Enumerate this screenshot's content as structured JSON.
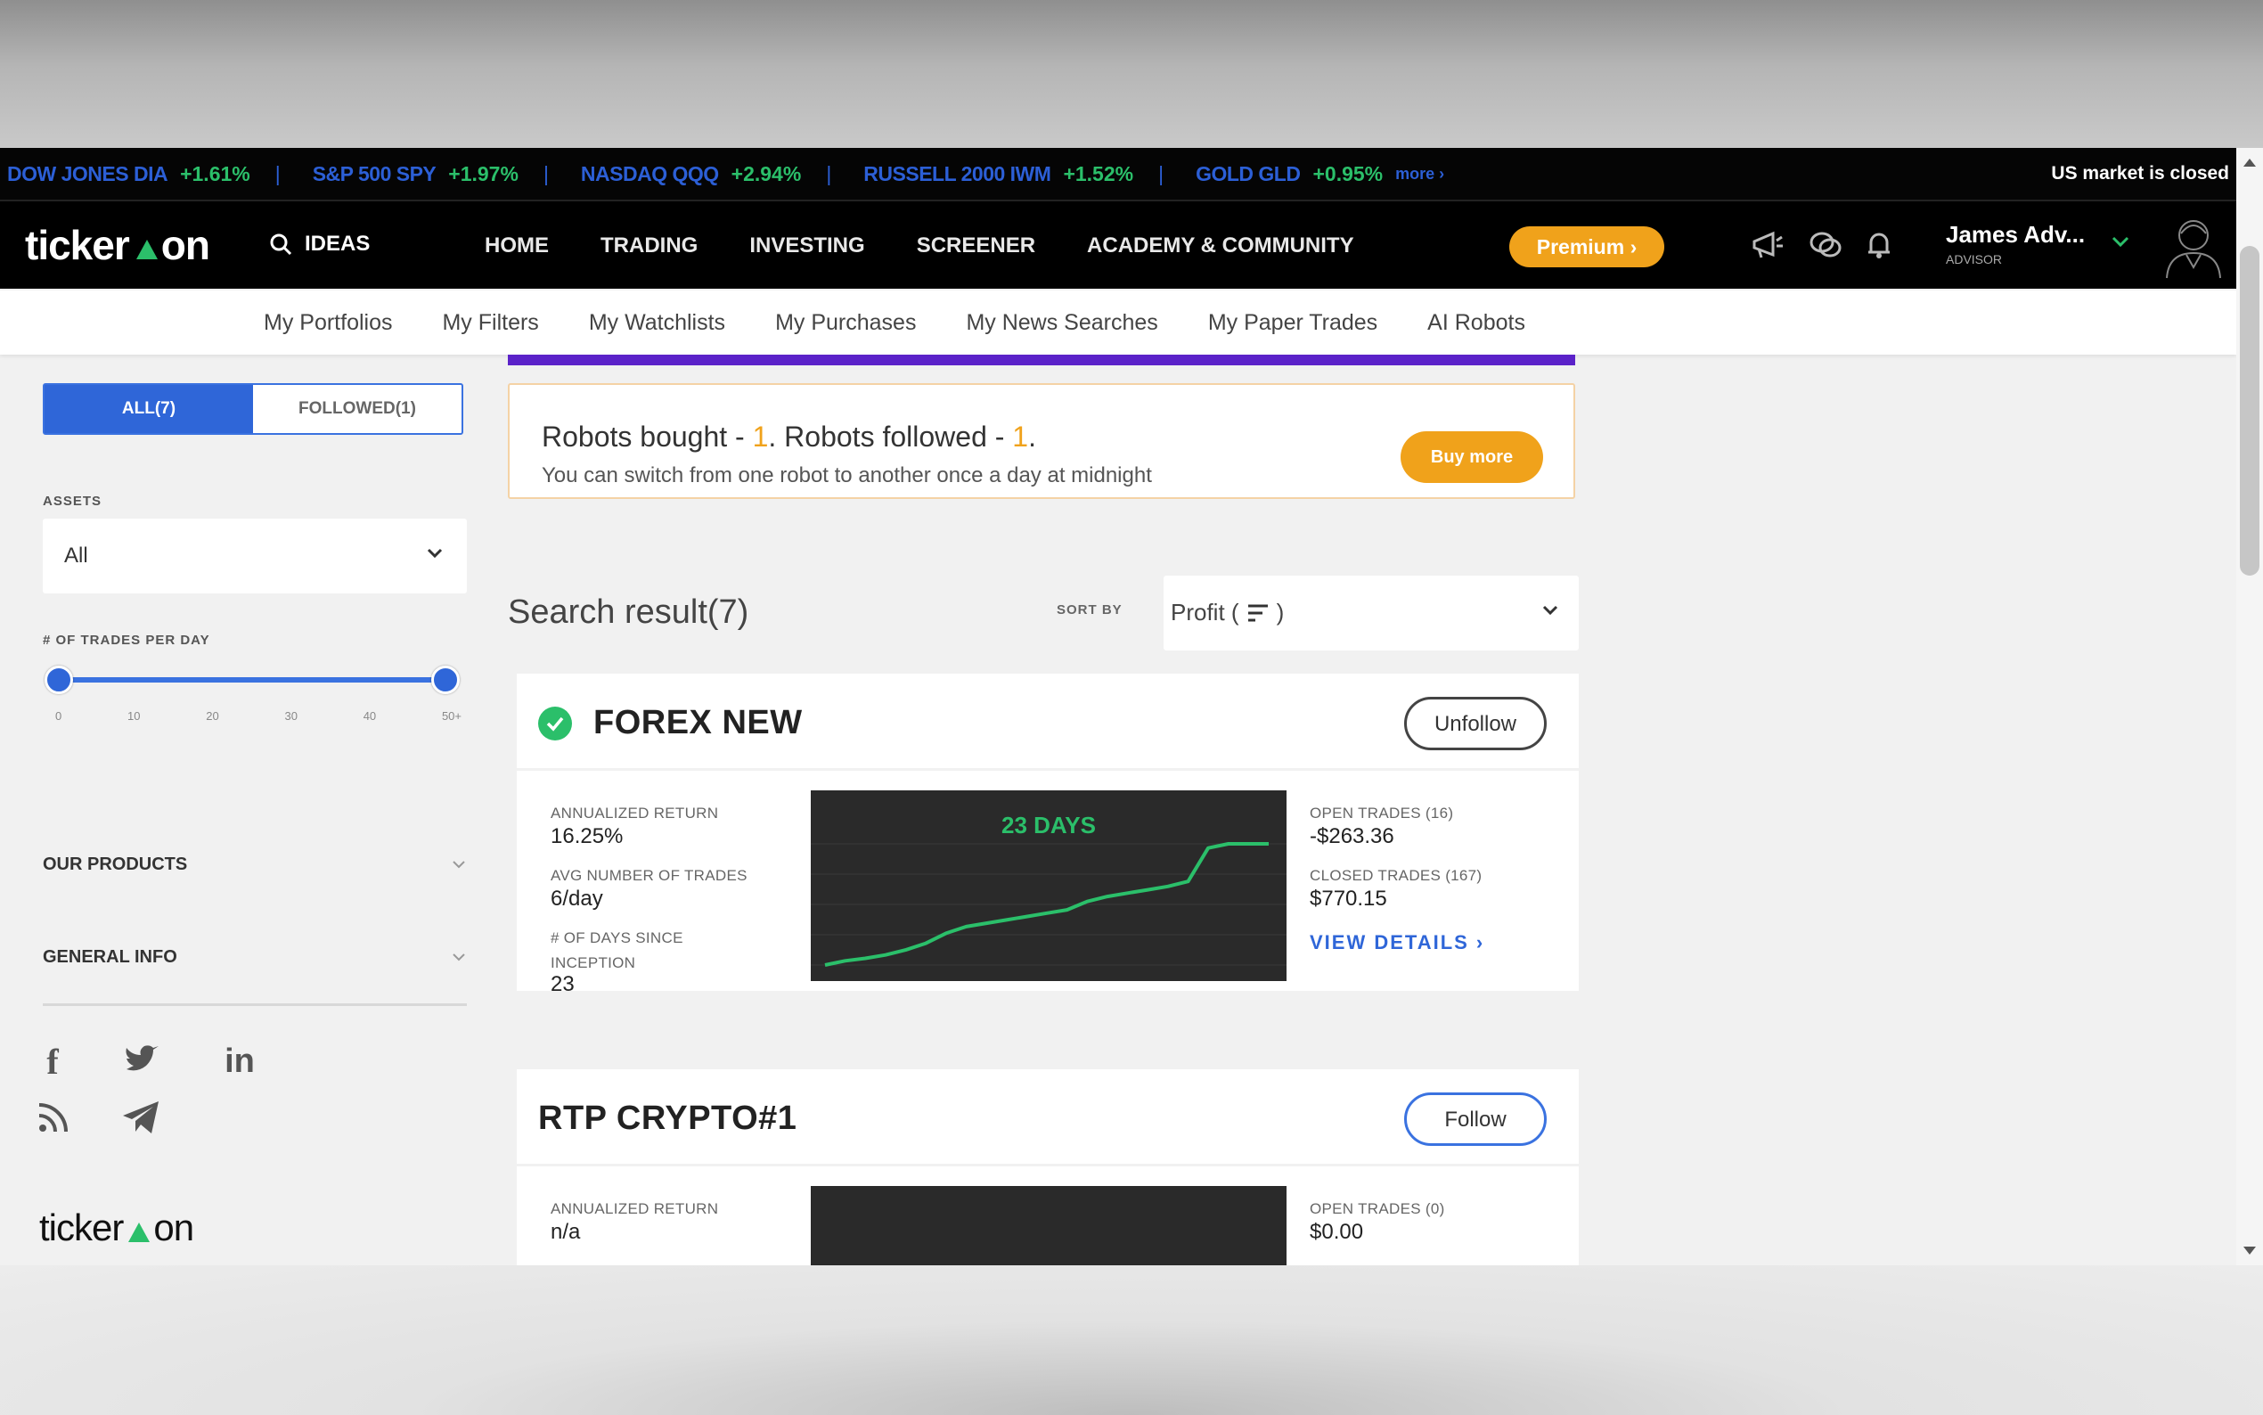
{
  "ticker": {
    "items": [
      {
        "name": "DOW JONES DIA",
        "change": "+1.61%"
      },
      {
        "name": "S&P 500 SPY",
        "change": "+1.97%"
      },
      {
        "name": "NASDAQ QQQ",
        "change": "+2.94%"
      },
      {
        "name": "RUSSELL 2000 IWM",
        "change": "+1.52%"
      },
      {
        "name": "GOLD GLD",
        "change": "+0.95%"
      }
    ],
    "more": "more ›",
    "market_status": "US market is closed"
  },
  "nav": {
    "logo_left": "ticker",
    "logo_right": "on",
    "ideas": "IDEAS",
    "links": [
      "HOME",
      "TRADING",
      "INVESTING",
      "SCREENER",
      "ACADEMY & COMMUNITY"
    ],
    "premium": "Premium ›",
    "user_name": "James Adv...",
    "user_role": "ADVISOR"
  },
  "subnav": [
    "My Portfolios",
    "My Filters",
    "My Watchlists",
    "My Purchases",
    "My News Searches",
    "My Paper Trades",
    "AI Robots"
  ],
  "sidebar": {
    "tab_all": "ALL(7)",
    "tab_followed": "FOLLOWED(1)",
    "assets_label": "ASSETS",
    "assets_value": "All",
    "trades_label": "# OF TRADES PER DAY",
    "trades_range": [
      0,
      50
    ],
    "ticks": [
      "0",
      "10",
      "20",
      "30",
      "40",
      "50+"
    ],
    "our_products": "OUR PRODUCTS",
    "general_info": "GENERAL INFO",
    "social_icons": [
      "facebook-icon",
      "twitter-icon",
      "linkedin-icon",
      "rss-icon",
      "telegram-icon"
    ],
    "footer_logo_left": "ticker",
    "footer_logo_right": "on"
  },
  "robots_info": {
    "bought_label": "Robots bought - ",
    "bought_count": "1",
    "followed_label": ". Robots followed - ",
    "followed_count": "1",
    "end": ".",
    "note": "You can switch from one robot to another once a day at midnight",
    "buy_more": "Buy more"
  },
  "search": {
    "result": "Search result(7)",
    "sort_by": "SORT BY",
    "sort_value_prefix": "Profit (",
    "sort_value_suffix": ")"
  },
  "cards": [
    {
      "title": "FOREX NEW",
      "followed": true,
      "button": "Unfollow",
      "annualized_return_label": "ANNUALIZED RETURN",
      "annualized_return": "16.25%",
      "avg_trades_label": "AVG NUMBER OF TRADES",
      "avg_trades": "6/day",
      "days_label_1": "# OF DAYS SINCE",
      "days_label_2": "INCEPTION",
      "days": "23",
      "chart_title": "23 DAYS",
      "open_trades_label": "OPEN TRADES (16)",
      "open_trades": "-$263.36",
      "closed_trades_label": "CLOSED TRADES (167)",
      "closed_trades": "$770.15",
      "view_details": "VIEW DETAILS ›"
    },
    {
      "title": "RTP CRYPTO#1",
      "followed": false,
      "button": "Follow",
      "annualized_return_label": "ANNUALIZED RETURN",
      "annualized_return": "n/a",
      "open_trades_label": "OPEN TRADES (0)",
      "open_trades": "$0.00"
    }
  ],
  "chart_data": {
    "type": "line",
    "title": "23 DAYS",
    "x": [
      0,
      1,
      2,
      3,
      4,
      5,
      6,
      7,
      8,
      9,
      10,
      11,
      12,
      13,
      14,
      15,
      16,
      17,
      18,
      19,
      20,
      21,
      22
    ],
    "y": [
      0,
      5,
      8,
      12,
      18,
      26,
      38,
      46,
      50,
      54,
      58,
      62,
      66,
      76,
      82,
      86,
      90,
      94,
      100,
      140,
      145,
      145,
      145
    ],
    "color": "#2bbf6a"
  },
  "colors": {
    "accent_blue": "#2f66d8",
    "premium_orange": "#f0a21b",
    "positive_green": "#2bbf6a",
    "purple_bar": "#5b22c9"
  }
}
